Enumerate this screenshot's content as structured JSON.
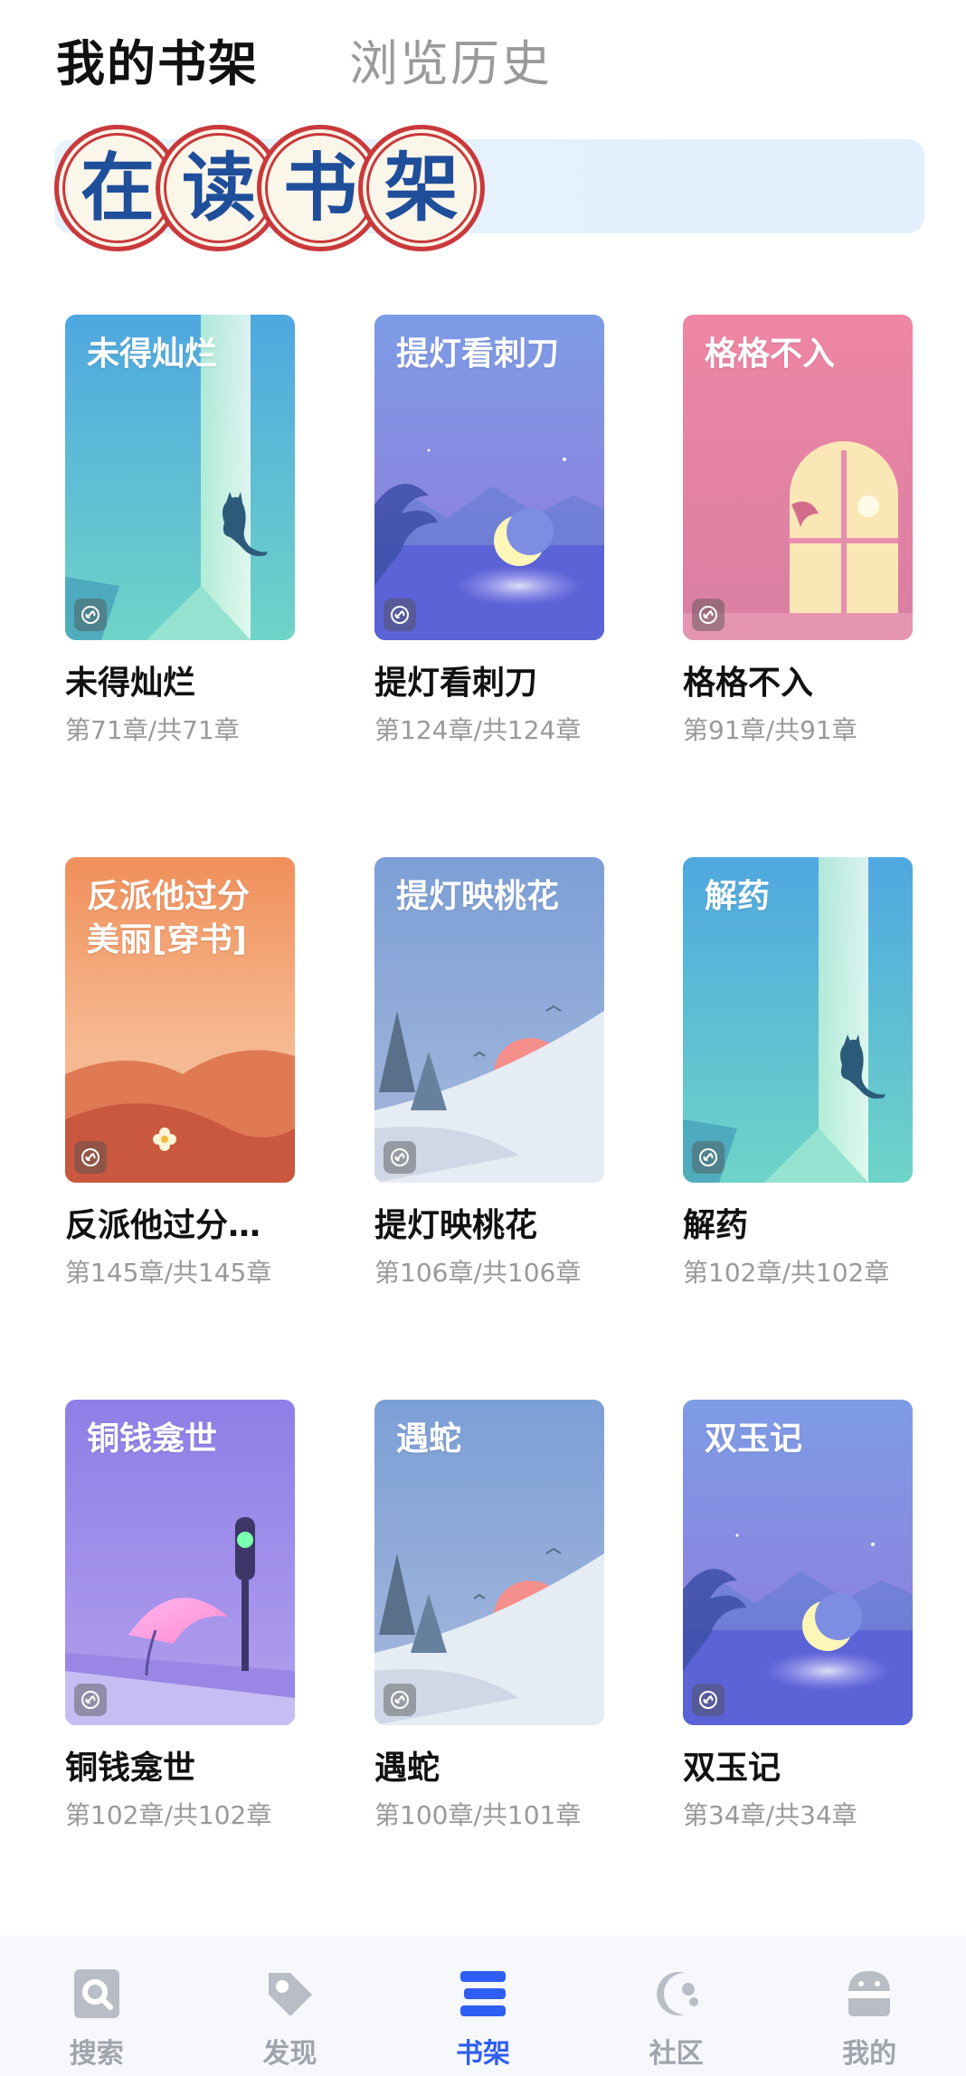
{
  "header": {
    "tabs": [
      {
        "label": "我的书架",
        "active": true
      },
      {
        "label": "浏览历史",
        "active": false
      }
    ]
  },
  "banner": {
    "chars": [
      "在",
      "读",
      "书",
      "架"
    ]
  },
  "books": [
    {
      "cover_title": "未得灿烂",
      "title": "未得灿烂",
      "progress": "第71章/共71章",
      "art": "cat-window"
    },
    {
      "cover_title": "提灯看刺刀",
      "title": "提灯看刺刀",
      "progress": "第124章/共124章",
      "art": "moon-lake"
    },
    {
      "cover_title": "格格不入",
      "title": "格格不入",
      "progress": "第91章/共91章",
      "art": "pink-window"
    },
    {
      "cover_title": "反派他过分美丽[穿书]",
      "title": "反派他过分…",
      "progress": "第145章/共145章",
      "art": "desert-flower"
    },
    {
      "cover_title": "提灯映桃花",
      "title": "提灯映桃花",
      "progress": "第106章/共106章",
      "art": "trees-sun"
    },
    {
      "cover_title": "解药",
      "title": "解药",
      "progress": "第102章/共102章",
      "art": "cat-window"
    },
    {
      "cover_title": "铜钱龛世",
      "title": "铜钱龛世",
      "progress": "第102章/共102章",
      "art": "umbrella-light"
    },
    {
      "cover_title": "遇蛇",
      "title": "遇蛇",
      "progress": "第100章/共101章",
      "art": "trees-sun"
    },
    {
      "cover_title": "双玉记",
      "title": "双玉记",
      "progress": "第34章/共34章",
      "art": "moon-lake"
    }
  ],
  "bottom_nav": {
    "items": [
      {
        "label": "搜索",
        "icon": "search-icon",
        "active": false
      },
      {
        "label": "发现",
        "icon": "tag-icon",
        "active": false
      },
      {
        "label": "书架",
        "icon": "bookshelf-icon",
        "active": true
      },
      {
        "label": "社区",
        "icon": "community-icon",
        "active": false
      },
      {
        "label": "我的",
        "icon": "profile-icon",
        "active": false
      }
    ]
  },
  "colors": {
    "accent": "#2f5ef3",
    "seal_red": "#c9393c",
    "seal_blue": "#1f4e9a",
    "nav_inactive": "#a0a4ad"
  }
}
